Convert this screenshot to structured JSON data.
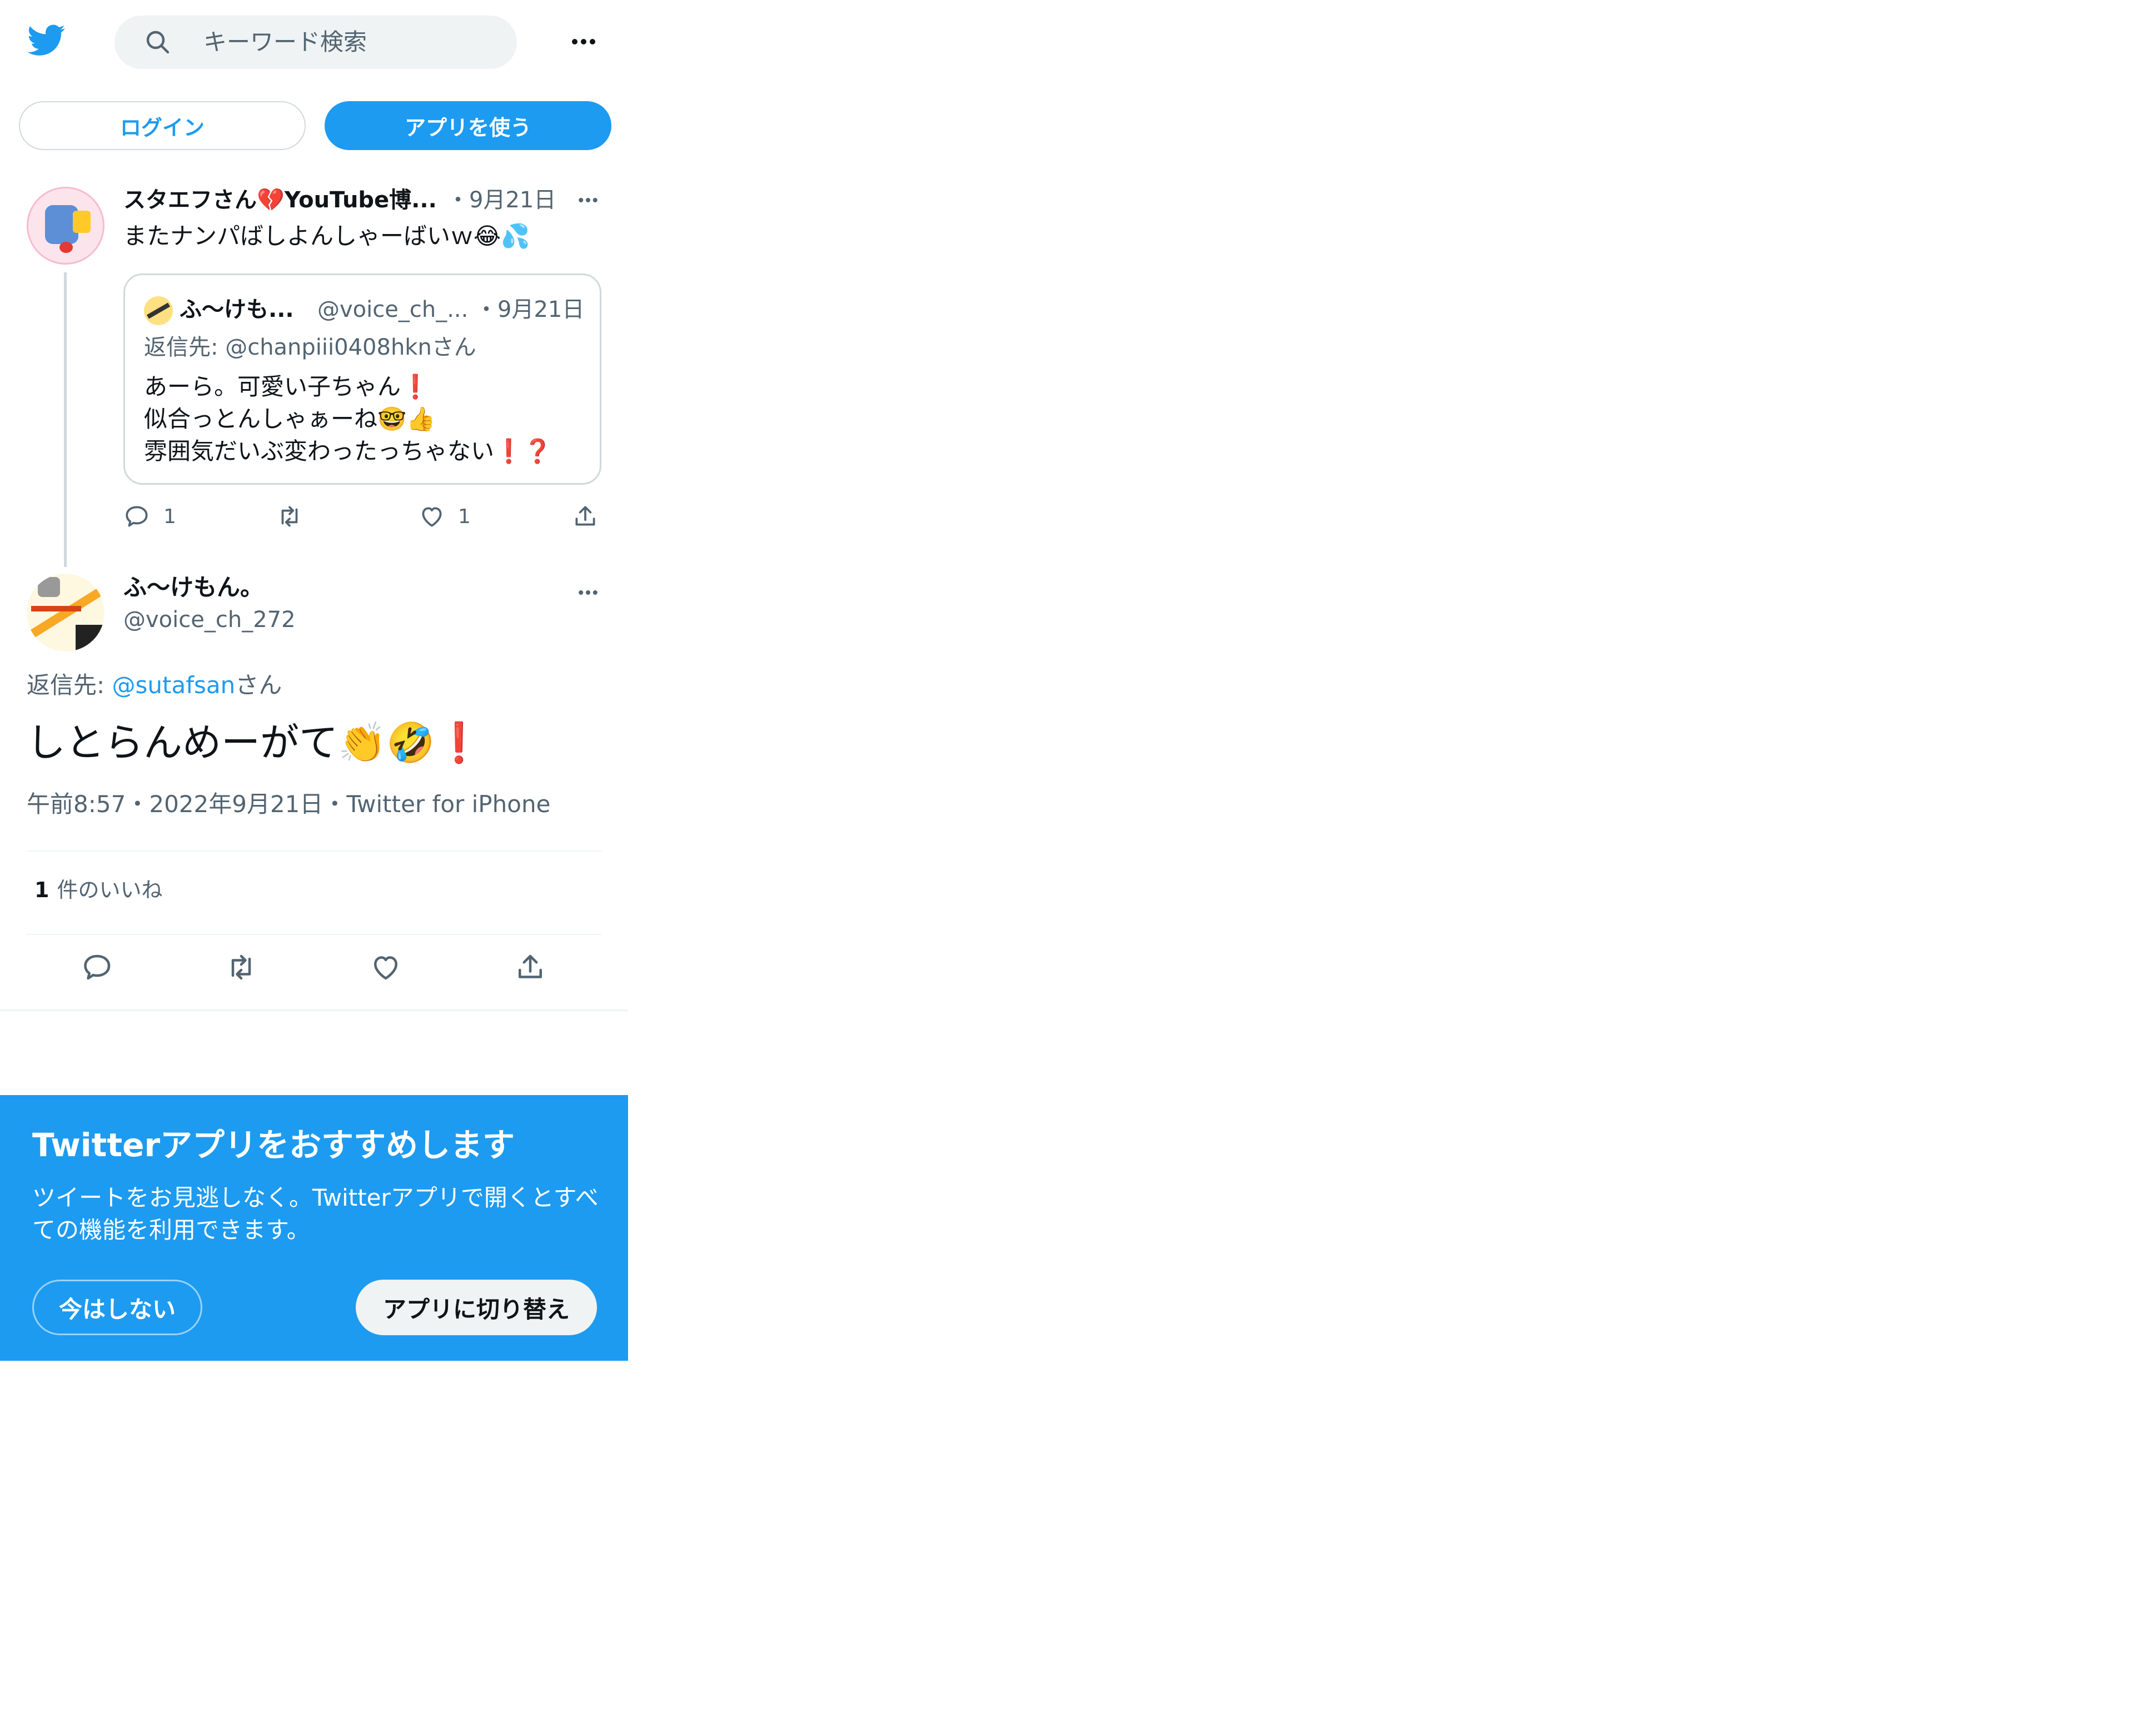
{
  "header": {
    "logo_icon": "twitter-bird-icon",
    "search_placeholder": "キーワード検索",
    "more_icon": "more-horizontal-icon"
  },
  "auth": {
    "login_label": "ログイン",
    "use_app_label": "アプリを使う"
  },
  "parent_tweet": {
    "display_name": "スタエフさん💔YouTube博...",
    "date": "・9月21日",
    "text": "またナンパばしよんしゃーばいｗ😂💦",
    "quoted": {
      "display_name": "ふ〜けも...",
      "handle": "@voice_ch_...",
      "date": "・9月21日",
      "reply_prefix": "返信先: ",
      "reply_handle": "@chanpiii0408hkn",
      "reply_suffix": "さん",
      "lines": [
        "あーら。可愛い子ちゃん❗",
        "似合っとんしゃぁーね🤓👍",
        "雰囲気だいぶ変わったっちゃない❗❓"
      ]
    },
    "reply_count": "1",
    "like_count": "1"
  },
  "main_tweet": {
    "display_name": "ふ〜けもん。",
    "handle": "@voice_ch_272",
    "reply_prefix": "返信先: ",
    "reply_handle": "@sutafsan",
    "reply_suffix": "さん",
    "text": "しとらんめーがて👏🤣❗",
    "meta_time": "午前8:57",
    "meta_date": "2022年9月21日",
    "meta_source": "Twitter for iPhone",
    "like_count": "1",
    "like_label": "件のいいね"
  },
  "banner": {
    "title": "Twitterアプリをおすすめします",
    "body": "ツイートをお見逃しなく。Twitterアプリで開くとすべての機能を利用できます。",
    "not_now_label": "今はしない",
    "switch_label": "アプリに切り替え"
  },
  "colors": {
    "brand": "#1d9bf0",
    "banner_bg": "#1d9bf0",
    "text": "#0f1419",
    "muted": "#536471",
    "border": "#cfd9de"
  }
}
